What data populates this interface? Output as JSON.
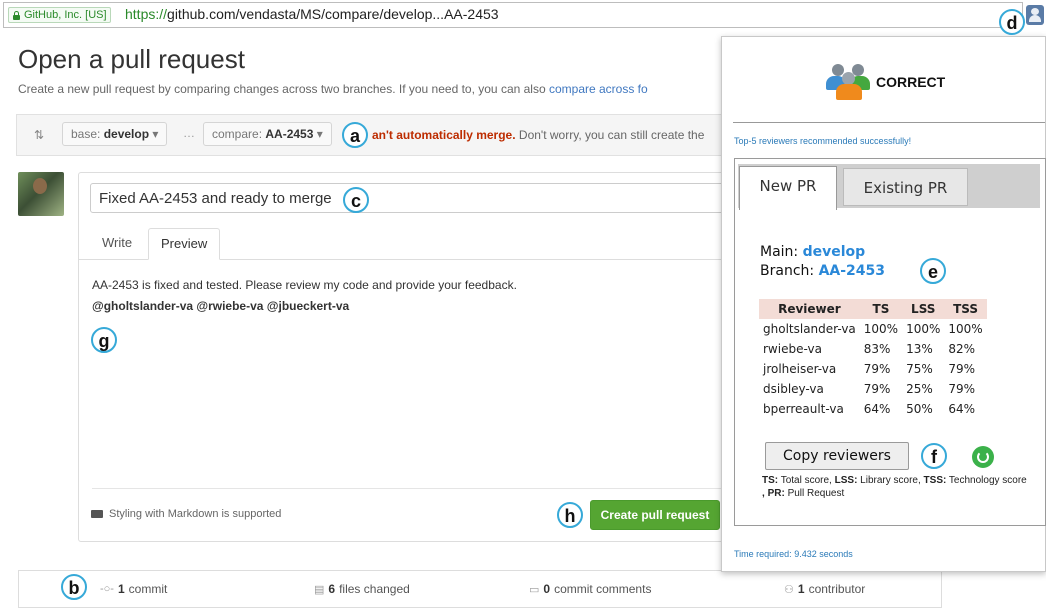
{
  "browser": {
    "security_label": "GitHub, Inc. [US]",
    "url_scheme": "https://",
    "url_rest": "github.com/vendasta/MS/compare/develop...AA-2453"
  },
  "callouts": {
    "a": "a",
    "b": "b",
    "c": "c",
    "d": "d",
    "e": "e",
    "f": "f",
    "g": "g",
    "h": "h"
  },
  "page": {
    "title": "Open a pull request",
    "subtitle": "Create a new pull request by comparing changes across two branches. If you need to, you can also ",
    "subtitle_link": "compare across fo"
  },
  "compare": {
    "base_prefix": "base:",
    "base_branch": "develop",
    "dots": "…",
    "compare_prefix": "compare:",
    "compare_branch": "AA-2453",
    "merge_bold": "an't automatically merge.",
    "merge_rest": " Don't worry, you can still create the"
  },
  "pr_form": {
    "title_value": "Fixed AA-2453 and ready to merge",
    "tab_write": "Write",
    "tab_preview": "Preview",
    "preview_text": "AA-2453 is fixed and tested. Please review my code and provide your feedback.",
    "mentions": "@gholtslander-va @rwiebe-va @jbueckert-va",
    "markdown_note": "Styling with Markdown is supported",
    "create_button": "Create pull request"
  },
  "stats": {
    "commits_count": "1",
    "commits_label": " commit",
    "files_count": "6",
    "files_label": " files changed",
    "comments_count": "0",
    "comments_label": " commit comments",
    "contributors_count": "1",
    "contributors_label": " contributor"
  },
  "popup": {
    "brand": "CORRECT",
    "status": "Top-5 reviewers recommended successfully!",
    "tab_new": "New PR",
    "tab_existing": "Existing PR",
    "main_label": "Main: ",
    "main_value": "develop",
    "branch_label": "Branch: ",
    "branch_value": "AA-2453",
    "table_headers": [
      "Reviewer",
      "TS",
      "LSS",
      "TSS"
    ],
    "reviewers": [
      {
        "name": "gholtslander-va",
        "ts": "100%",
        "lss": "100%",
        "tss": "100%"
      },
      {
        "name": "rwiebe-va",
        "ts": "83%",
        "lss": "13%",
        "tss": "82%"
      },
      {
        "name": "jrolheiser-va",
        "ts": "79%",
        "lss": "75%",
        "tss": "79%"
      },
      {
        "name": "dsibley-va",
        "ts": "79%",
        "lss": "25%",
        "tss": "79%"
      },
      {
        "name": "bperreault-va",
        "ts": "64%",
        "lss": "50%",
        "tss": "64%"
      }
    ],
    "copy_button": "Copy reviewers",
    "legend": {
      "ts_key": "TS:",
      "ts_val": " Total score, ",
      "lss_key": "LSS:",
      "lss_val": " Library score, ",
      "tss_key": "TSS:",
      "tss_val": " Technology score",
      "sep": " , ",
      "pr_key": "PR:",
      "pr_val": " Pull Request"
    },
    "time": "Time required: 9.432 seconds"
  },
  "colors": {
    "accent_blue": "#2a88d8",
    "create_green": "#55a532",
    "callout_border": "#36a9d8",
    "header_row": "#f3dcd6"
  }
}
